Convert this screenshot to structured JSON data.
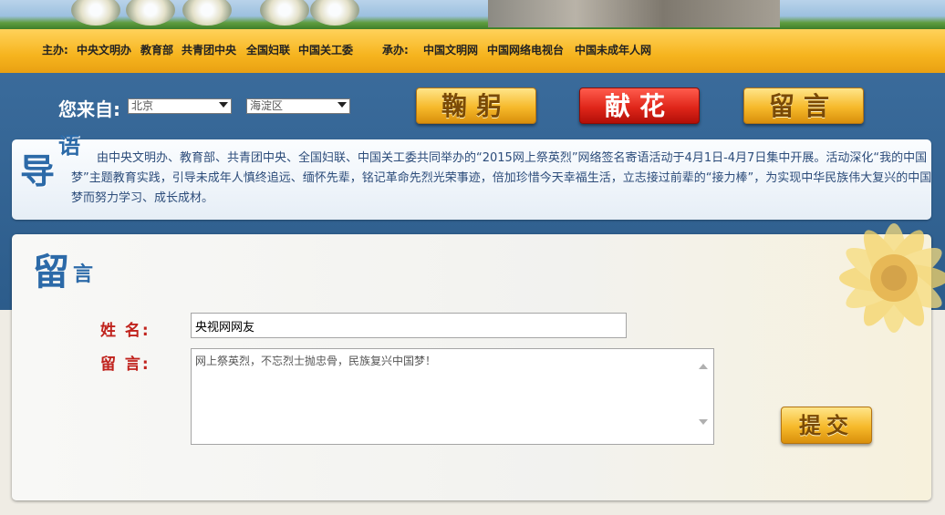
{
  "header": {
    "sponsors_label": "主办:",
    "sponsors": [
      "中央文明办",
      "教育部",
      "共青团中央",
      "全国妇联",
      "中国关工委"
    ],
    "organizers_label": "承办:",
    "organizers": [
      "中国文明网",
      "中国网络电视台",
      "中国未成年人网"
    ]
  },
  "location": {
    "label": "您来自:",
    "province": "北京",
    "district": "海淀区"
  },
  "actions": {
    "bow": "鞠躬",
    "flowers": "献花",
    "message": "留言"
  },
  "intro": {
    "logo_big": "导",
    "logo_small": "语",
    "text": "由中央文明办、教育部、共青团中央、全国妇联、中国关工委共同举办的“2015网上祭英烈”网络签名寄语活动于4月1日-4月7日集中开展。活动深化“我的中国梦”主题教育实践，引导未成年人慎终追远、缅怀先辈，铭记革命先烈光荣事迹，倍加珍惜今天幸福生活，立志接过前辈的“接力棒”，为实现中华民族伟大复兴的中国梦而努力学习、成长成材。"
  },
  "form": {
    "logo_big": "留",
    "logo_small": "言",
    "name_label": "姓  名:",
    "name_value": "央视网网友",
    "message_label": "留  言:",
    "message_value": "网上祭英烈，不忘烈士抛忠骨，民族复兴中国梦！",
    "submit_label": "提交"
  },
  "colors": {
    "accent_blue": "#2c5c8b",
    "gold": "#f6b41e",
    "red_button": "#e0261a",
    "label_red": "#c0221c"
  }
}
